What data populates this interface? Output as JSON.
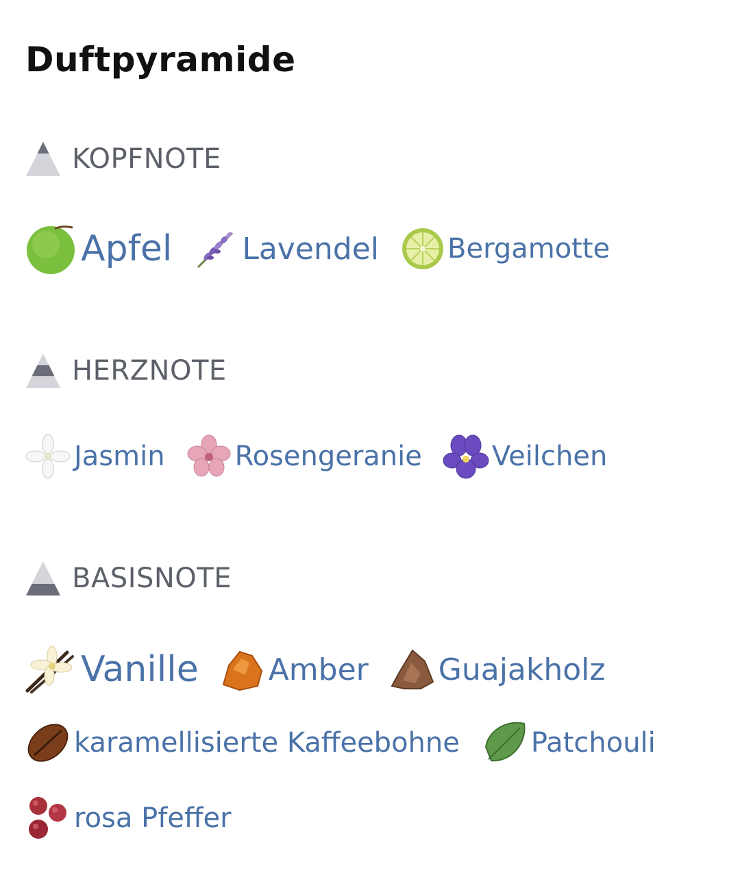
{
  "page": {
    "title": "Duftpyramide"
  },
  "sections": [
    {
      "label": "KOPFNOTE",
      "pyramid_level": "top",
      "notes": [
        {
          "name": "Apfel",
          "icon": "green-apple-icon",
          "emphasis": "large"
        },
        {
          "name": "Lavendel",
          "icon": "lavender-icon",
          "emphasis": "medium"
        },
        {
          "name": "Bergamotte",
          "icon": "bergamot-icon",
          "emphasis": "normal"
        }
      ]
    },
    {
      "label": "HERZNOTE",
      "pyramid_level": "middle",
      "notes": [
        {
          "name": "Jasmin",
          "icon": "jasmine-icon",
          "emphasis": "normal"
        },
        {
          "name": "Rosengeranie",
          "icon": "rose-geranium-icon",
          "emphasis": "normal"
        },
        {
          "name": "Veilchen",
          "icon": "violet-icon",
          "emphasis": "normal"
        }
      ]
    },
    {
      "label": "BASISNOTE",
      "pyramid_level": "base",
      "notes": [
        {
          "name": "Vanille",
          "icon": "vanilla-icon",
          "emphasis": "large"
        },
        {
          "name": "Amber",
          "icon": "amber-icon",
          "emphasis": "medium"
        },
        {
          "name": "Guajakholz",
          "icon": "guaiac-wood-icon",
          "emphasis": "medium"
        },
        {
          "name": "karamellisierte Kaffeebohne",
          "icon": "coffee-bean-icon",
          "emphasis": "normal"
        },
        {
          "name": "Patchouli",
          "icon": "patchouli-leaf-icon",
          "emphasis": "normal"
        },
        {
          "name": "rosa Pfeffer",
          "icon": "pink-pepper-icon",
          "emphasis": "normal"
        }
      ]
    }
  ],
  "colors": {
    "note_text": "#4a72a8",
    "section_label": "#5c6068",
    "title": "#111111",
    "pyramid_light": "#d4d5da",
    "pyramid_dark": "#6b6d78"
  }
}
